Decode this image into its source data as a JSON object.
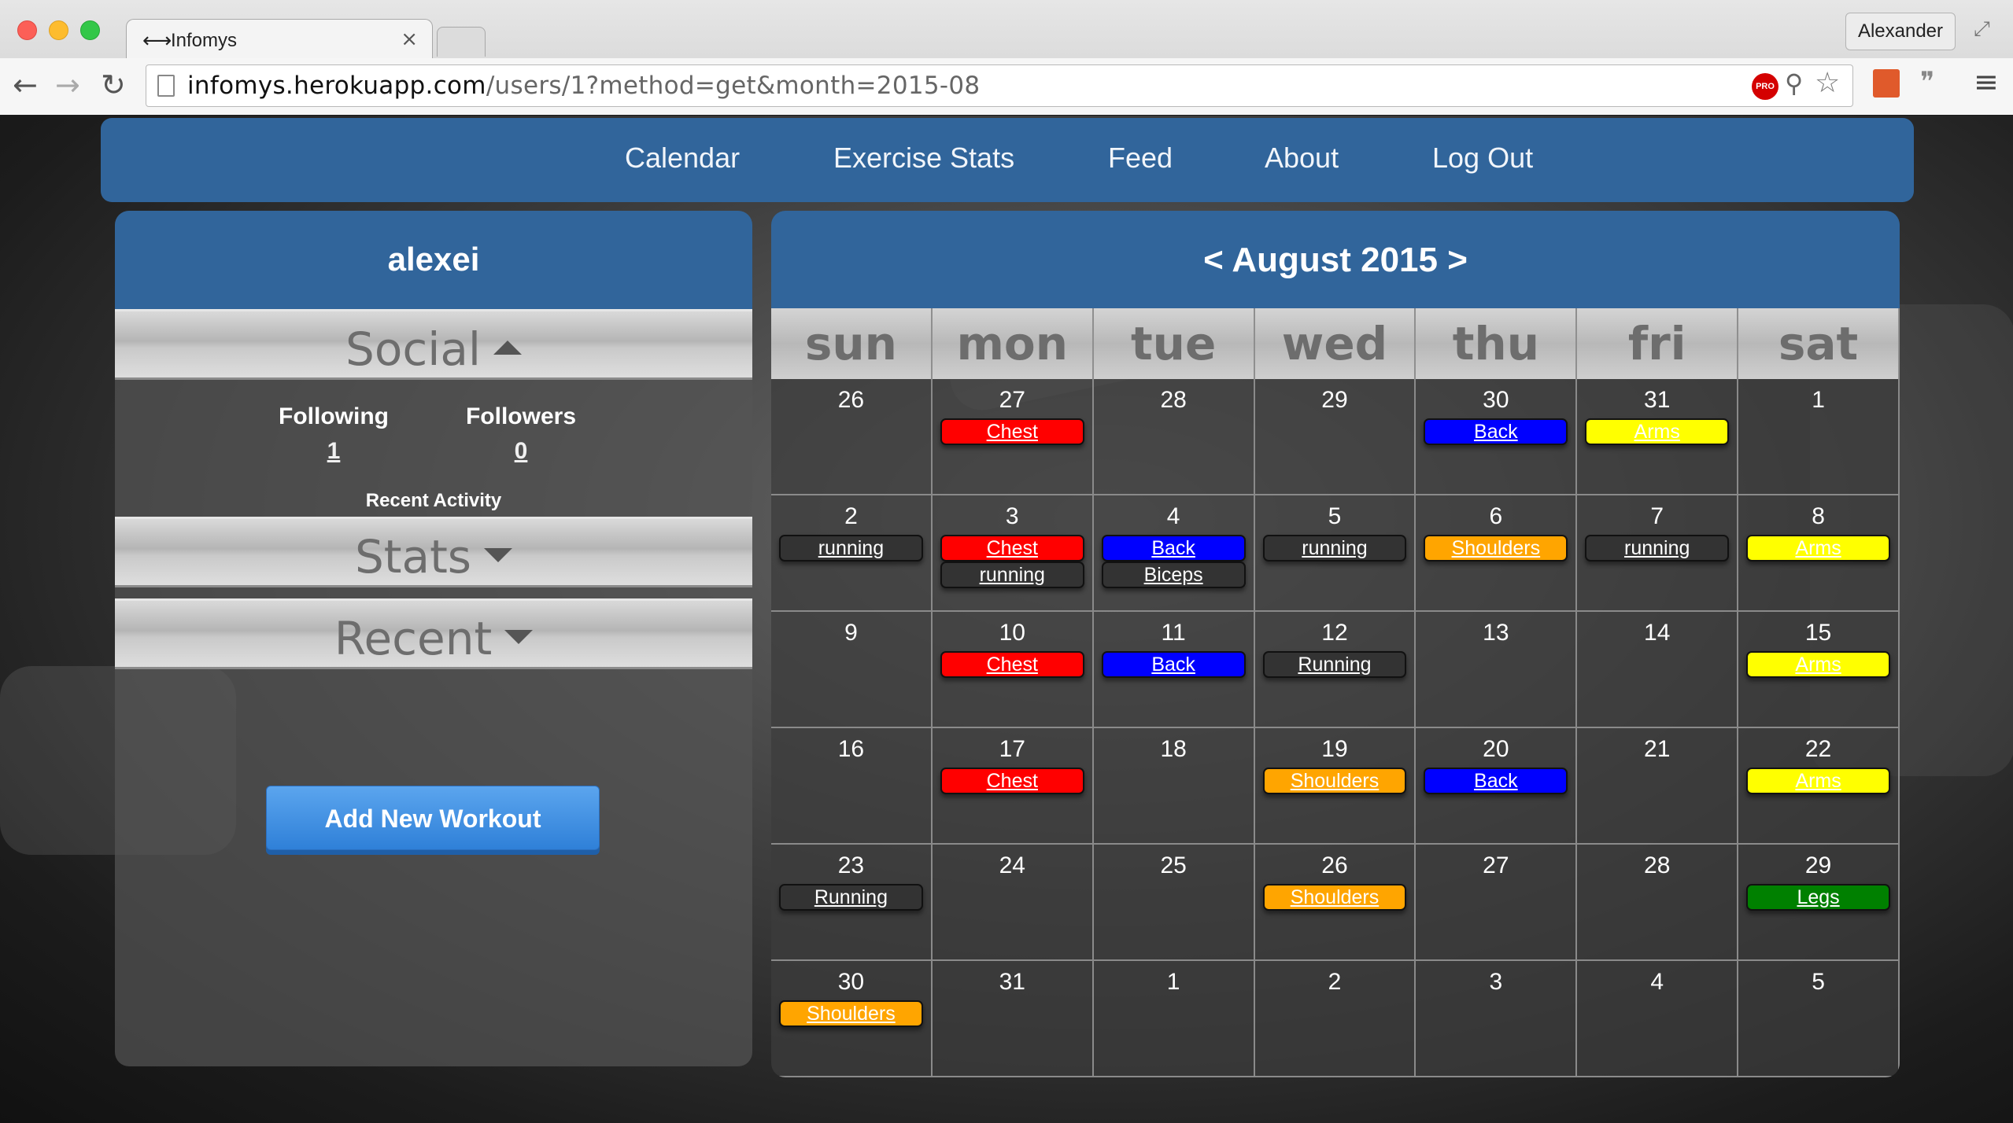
{
  "browser": {
    "tab_title": "Infomys",
    "tab_icon": "dumbbell-icon",
    "profile_name": "Alexander",
    "url_host": "infomys.herokuapp.com",
    "url_path": "/users/1?method=get&month=2015-08",
    "pro_badge": "PRO"
  },
  "nav": {
    "items": [
      "Calendar",
      "Exercise Stats",
      "Feed",
      "About",
      "Log Out"
    ]
  },
  "sidebar": {
    "username": "alexei",
    "social_label": "Social",
    "following_label": "Following",
    "following_count": "1",
    "followers_label": "Followers",
    "followers_count": "0",
    "recent_activity_label": "Recent Activity",
    "stats_label": "Stats",
    "recent_label": "Recent",
    "add_workout_label": "Add New Workout"
  },
  "calendar": {
    "title": "< August 2015 >",
    "weekdays": [
      "sun",
      "mon",
      "tue",
      "wed",
      "thu",
      "fri",
      "sat"
    ],
    "weeks": [
      [
        {
          "day": "26",
          "events": []
        },
        {
          "day": "27",
          "events": [
            {
              "label": "Chest",
              "color": "#ff0000"
            }
          ]
        },
        {
          "day": "28",
          "events": []
        },
        {
          "day": "29",
          "events": []
        },
        {
          "day": "30",
          "events": [
            {
              "label": "Back",
              "color": "#0000ff"
            }
          ]
        },
        {
          "day": "31",
          "events": [
            {
              "label": "Arms",
              "color": "#ffff00"
            }
          ]
        },
        {
          "day": "1",
          "events": []
        }
      ],
      [
        {
          "day": "2",
          "events": [
            {
              "label": "running",
              "color": "#333333"
            }
          ]
        },
        {
          "day": "3",
          "events": [
            {
              "label": "Chest",
              "color": "#ff0000"
            },
            {
              "label": "running",
              "color": "#333333"
            }
          ]
        },
        {
          "day": "4",
          "events": [
            {
              "label": "Back",
              "color": "#0000ff"
            },
            {
              "label": "Biceps",
              "color": "#333333"
            }
          ]
        },
        {
          "day": "5",
          "events": [
            {
              "label": "running",
              "color": "#333333"
            }
          ]
        },
        {
          "day": "6",
          "events": [
            {
              "label": "Shoulders",
              "color": "#ffa500"
            }
          ]
        },
        {
          "day": "7",
          "events": [
            {
              "label": "running",
              "color": "#333333"
            }
          ]
        },
        {
          "day": "8",
          "events": [
            {
              "label": "Arms",
              "color": "#ffff00"
            }
          ]
        }
      ],
      [
        {
          "day": "9",
          "events": []
        },
        {
          "day": "10",
          "events": [
            {
              "label": "Chest",
              "color": "#ff0000"
            }
          ]
        },
        {
          "day": "11",
          "events": [
            {
              "label": "Back",
              "color": "#0000ff"
            }
          ]
        },
        {
          "day": "12",
          "events": [
            {
              "label": "Running",
              "color": "#333333"
            }
          ]
        },
        {
          "day": "13",
          "events": []
        },
        {
          "day": "14",
          "events": []
        },
        {
          "day": "15",
          "events": [
            {
              "label": "Arms",
              "color": "#ffff00"
            }
          ]
        }
      ],
      [
        {
          "day": "16",
          "events": []
        },
        {
          "day": "17",
          "events": [
            {
              "label": "Chest",
              "color": "#ff0000"
            }
          ]
        },
        {
          "day": "18",
          "events": []
        },
        {
          "day": "19",
          "events": [
            {
              "label": "Shoulders",
              "color": "#ffa500"
            }
          ]
        },
        {
          "day": "20",
          "events": [
            {
              "label": "Back",
              "color": "#0000ff"
            }
          ]
        },
        {
          "day": "21",
          "events": []
        },
        {
          "day": "22",
          "events": [
            {
              "label": "Arms",
              "color": "#ffff00"
            }
          ]
        }
      ],
      [
        {
          "day": "23",
          "events": [
            {
              "label": "Running",
              "color": "#333333"
            }
          ]
        },
        {
          "day": "24",
          "events": []
        },
        {
          "day": "25",
          "events": []
        },
        {
          "day": "26",
          "events": [
            {
              "label": "Shoulders",
              "color": "#ffa500"
            }
          ]
        },
        {
          "day": "27",
          "events": []
        },
        {
          "day": "28",
          "events": []
        },
        {
          "day": "29",
          "events": [
            {
              "label": "Legs",
              "color": "#008000"
            }
          ]
        }
      ],
      [
        {
          "day": "30",
          "events": [
            {
              "label": "Shoulders",
              "color": "#ffa500"
            }
          ]
        },
        {
          "day": "31",
          "events": []
        },
        {
          "day": "1",
          "events": []
        },
        {
          "day": "2",
          "events": []
        },
        {
          "day": "3",
          "events": []
        },
        {
          "day": "4",
          "events": []
        },
        {
          "day": "5",
          "events": []
        }
      ]
    ]
  }
}
